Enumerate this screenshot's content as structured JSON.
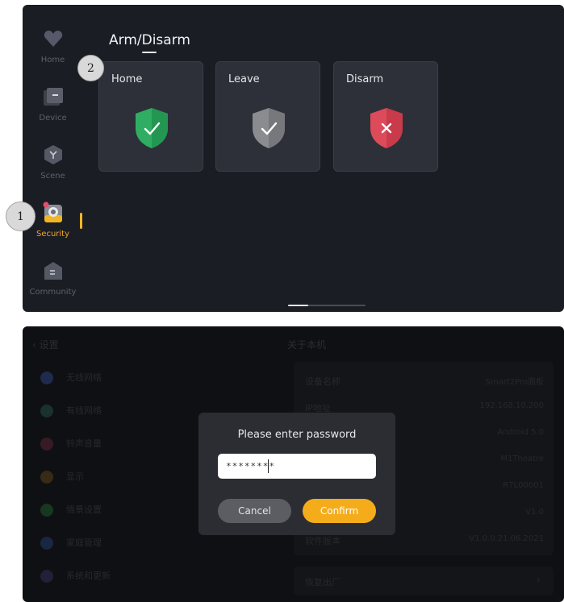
{
  "sidebar": {
    "items": [
      {
        "label": "Home",
        "icon": "heart-home-icon"
      },
      {
        "label": "Device",
        "icon": "device-icon"
      },
      {
        "label": "Scene",
        "icon": "scene-icon"
      },
      {
        "label": "Security",
        "icon": "security-camera-icon",
        "active": true
      },
      {
        "label": "Community",
        "icon": "community-icon"
      }
    ]
  },
  "main": {
    "title": "Arm/Disarm",
    "modes": [
      {
        "label": "Home",
        "color": "#2fae63",
        "icon": "check-shield-icon"
      },
      {
        "label": "Leave",
        "color": "#8a8c90",
        "icon": "check-shield-icon"
      },
      {
        "label": "Disarm",
        "color": "#dd4b5a",
        "icon": "x-shield-icon"
      }
    ]
  },
  "callouts": {
    "one": "1",
    "two": "2"
  },
  "password_dialog": {
    "title": "Please enter password",
    "value": "********",
    "cancel_label": "Cancel",
    "confirm_label": "Confirm"
  },
  "background_settings": {
    "back_label": "设置",
    "right_title": "关于本机",
    "list_items": [
      {
        "label": "无线网络",
        "color": "#2a3a66"
      },
      {
        "label": "有线网络",
        "color": "#22433a"
      },
      {
        "label": "铃声音量",
        "color": "#4a2330"
      },
      {
        "label": "显示",
        "color": "#4a3a1c"
      },
      {
        "label": "情景设置",
        "color": "#1f4a2c"
      },
      {
        "label": "家庭管理",
        "color": "#22355a"
      },
      {
        "label": "系统和更新",
        "color": "#2a2d48"
      }
    ],
    "info_rows": [
      {
        "key": "设备名称",
        "value": "Smart2Pro面板"
      },
      {
        "key": "IP地址",
        "value": "192.168.10.200"
      },
      {
        "key": "",
        "value": "Android 5.0"
      },
      {
        "key": "",
        "value": "M1Theatre"
      },
      {
        "key": "",
        "value": "R7L00001"
      },
      {
        "key": "",
        "value": "V1.0"
      },
      {
        "key": "软件版本",
        "value": "V1.0.0.21.06.2021"
      }
    ],
    "bottom_row_label": "恢复出厂"
  },
  "colors": {
    "accent": "#f4ac1a",
    "panel": "#1b1d24"
  }
}
